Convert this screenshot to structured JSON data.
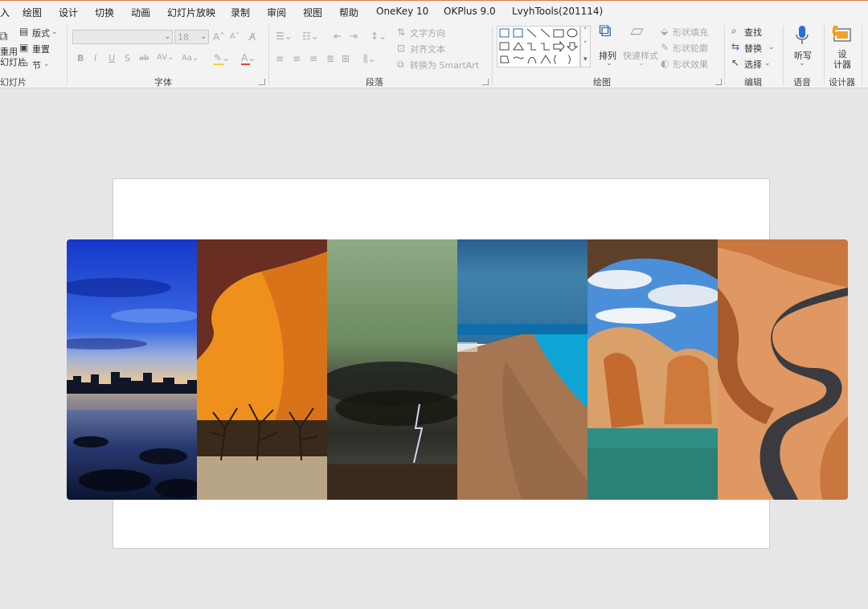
{
  "tabs": [
    "入",
    "绘图",
    "设计",
    "切换",
    "动画",
    "幻灯片放映",
    "录制",
    "审阅",
    "视图",
    "帮助",
    "OneKey 10",
    "OKPlus 9.0",
    "LvyhTools(201114)"
  ],
  "slides_group": {
    "reuse_label": "重用\n幻灯片",
    "layout_label": "版式",
    "reset_label": "重置",
    "section_label": "节",
    "group_label": "幻灯片"
  },
  "font_group": {
    "font_name": "",
    "font_size": "18",
    "group_label": "字体"
  },
  "paragraph_group": {
    "text_direction": "文字方向",
    "align_text": "对齐文本",
    "smartart": "转换为 SmartArt",
    "group_label": "段落"
  },
  "drawing_group": {
    "arrange_label": "排列",
    "quick_styles_label": "快速样式",
    "shape_fill": "形状填充",
    "shape_outline": "形状轮廓",
    "shape_effects": "形状效果",
    "group_label": "绘图"
  },
  "editing_group": {
    "find_label": "查找",
    "replace_label": "替换",
    "select_label": "选择",
    "group_label": "编辑"
  },
  "voice_group": {
    "dictate_label": "听写",
    "group_label": "语音"
  },
  "designer_group": {
    "designer_label": "设\n计器",
    "group_label": "设计器"
  },
  "slide_images": [
    {
      "name": "night-city-lake",
      "colors": [
        "#1a3ccf",
        "#3f6fe6",
        "#c9b7a0",
        "#1a2a55",
        "#0d1630"
      ]
    },
    {
      "name": "desert-dune-trees",
      "colors": [
        "#6b2f22",
        "#f08d1b",
        "#d9741a",
        "#3a2416",
        "#b7a484"
      ]
    },
    {
      "name": "storm-lightning",
      "colors": [
        "#8fa886",
        "#6f8a62",
        "#3d4436",
        "#1d1f1b",
        "#3a2a1c"
      ]
    },
    {
      "name": "beach-coast",
      "colors": [
        "#2f6f9e",
        "#0e9fd0",
        "#b07f5a",
        "#8e6244",
        "#a07558"
      ]
    },
    {
      "name": "sea-cliffs",
      "colors": [
        "#6b4a32",
        "#4a8fd8",
        "#d9e6f2",
        "#c7783c",
        "#2f8f86"
      ]
    },
    {
      "name": "mountain-road",
      "colors": [
        "#e09a64",
        "#c9773f",
        "#3b3b3f",
        "#f2d3b3",
        "#a85a2c"
      ]
    }
  ]
}
